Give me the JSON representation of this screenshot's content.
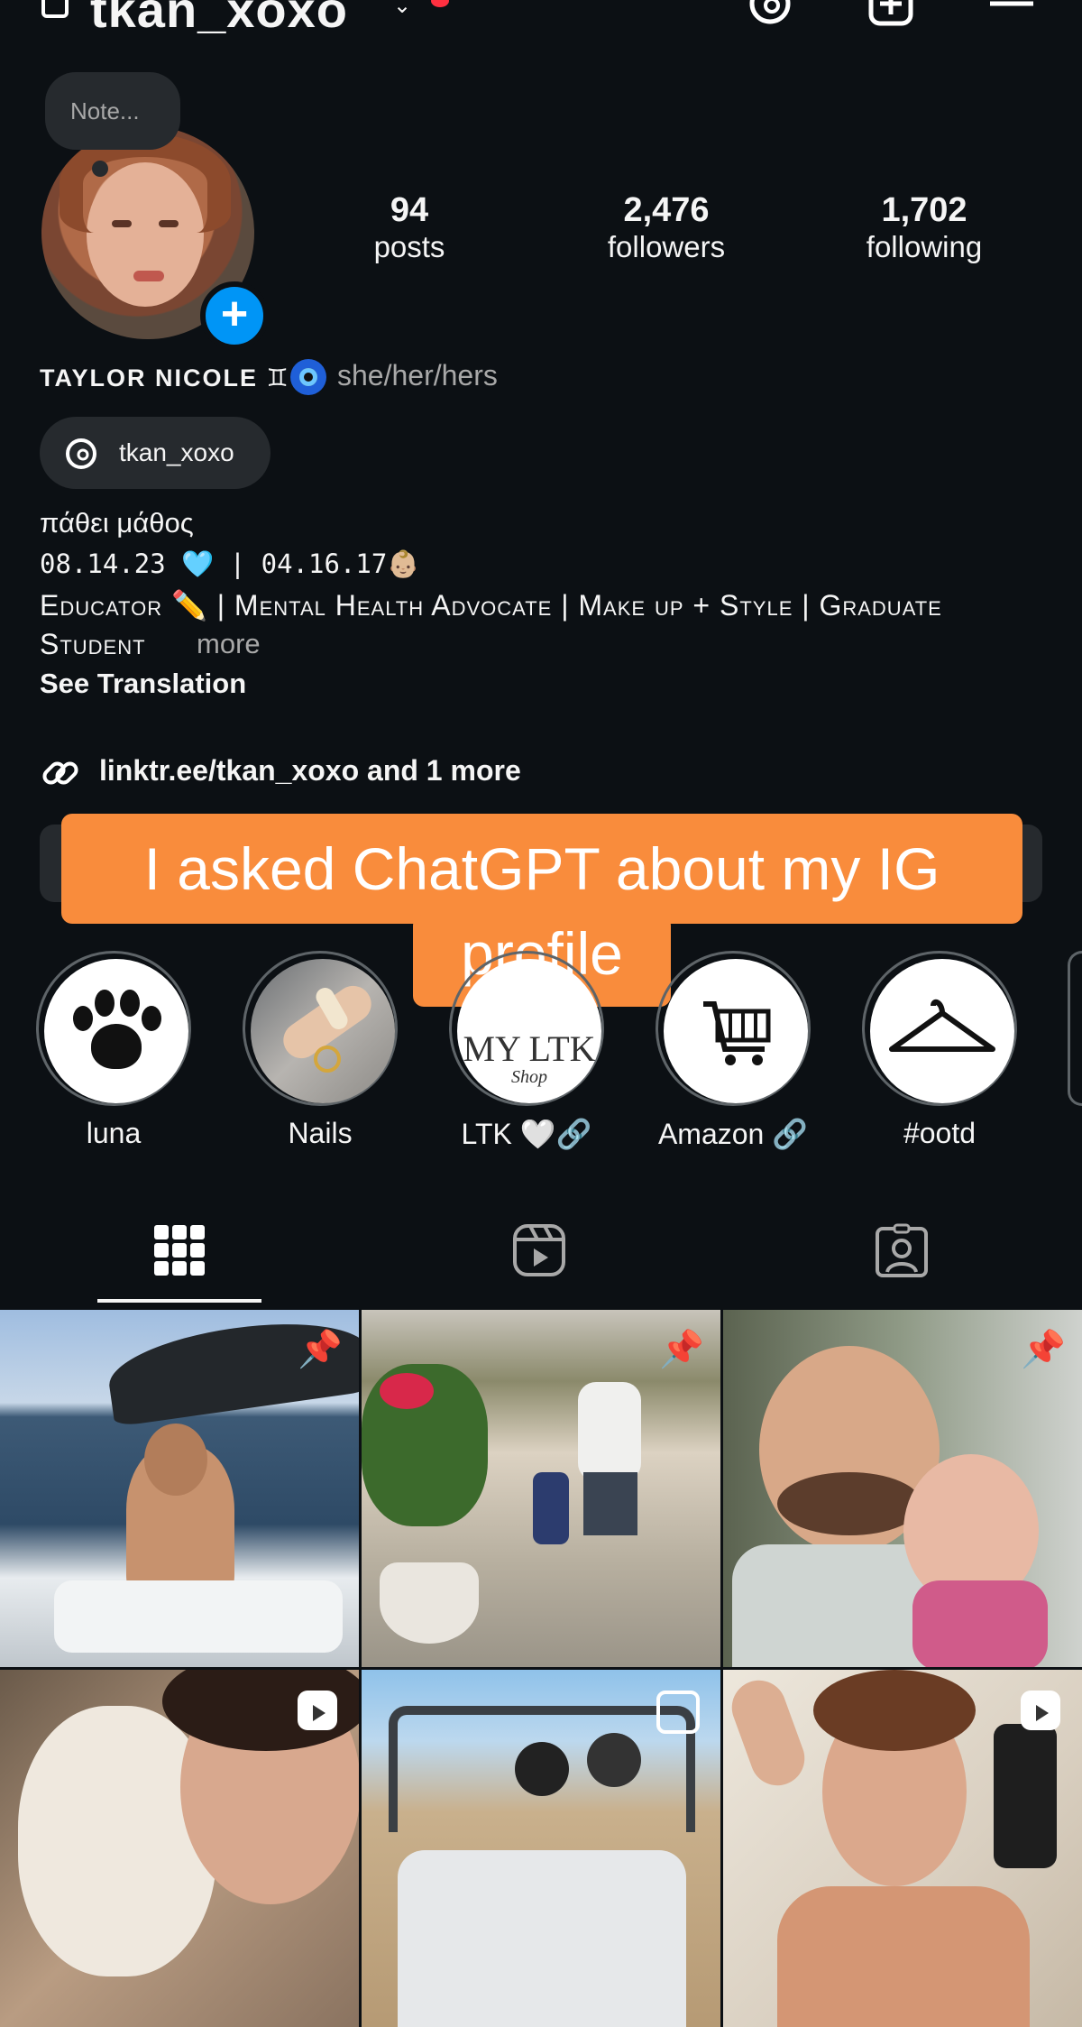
{
  "header": {
    "username": "tkan_xoxo"
  },
  "profile": {
    "note_placeholder": "Note...",
    "stats": [
      {
        "value": "94",
        "label": "posts"
      },
      {
        "value": "2,476",
        "label": "followers"
      },
      {
        "value": "1,702",
        "label": "following"
      }
    ],
    "name": "TAYLOR NICOLE ♊",
    "pronouns": "she/her/hers",
    "threads_handle": "tkan_xoxo",
    "bio_lines": [
      "πάθει μάθος",
      "08.14.23 🩵 | 04.16.17👶🏼",
      "Educator ✏️ | Mental Health Advocate | Make up + Style | Graduate",
      "Student"
    ],
    "more_label": "more",
    "see_translation": "See Translation",
    "link_text": "linktr.ee/tkan_xoxo and 1 more"
  },
  "overlay_caption": {
    "line1": "I asked ChatGPT about my IG",
    "line2": "profile"
  },
  "highlights": [
    {
      "label": "luna",
      "icon": "paw-icon"
    },
    {
      "label": "Nails",
      "icon": "nails-photo"
    },
    {
      "label": "LTK 🤍🔗",
      "icon": "ltk-logo",
      "logo_text": "MY LTK",
      "logo_sub": "Shop"
    },
    {
      "label": "Amazon 🔗",
      "icon": "cart-icon"
    },
    {
      "label": "#ootd",
      "icon": "hanger-icon"
    }
  ],
  "tabs": [
    "grid-icon",
    "reels-icon",
    "tagged-icon"
  ],
  "colors": {
    "background": "#0c1014",
    "caption_bg": "#f98c3c",
    "accent_blue": "#0095f6",
    "notification_red": "#ff3040"
  },
  "grid_posts": [
    {
      "subject": "boat-on-lake",
      "badge": "pin-icon"
    },
    {
      "subject": "father-daughter-steps",
      "badge": "pin-icon"
    },
    {
      "subject": "father-daughter-portrait",
      "badge": "pin-icon"
    },
    {
      "subject": "woman-with-dog",
      "badge": "reel-icon"
    },
    {
      "subject": "off-road-buggy",
      "badge": "carousel-icon"
    },
    {
      "subject": "mirror-selfie",
      "badge": "reel-icon"
    }
  ]
}
